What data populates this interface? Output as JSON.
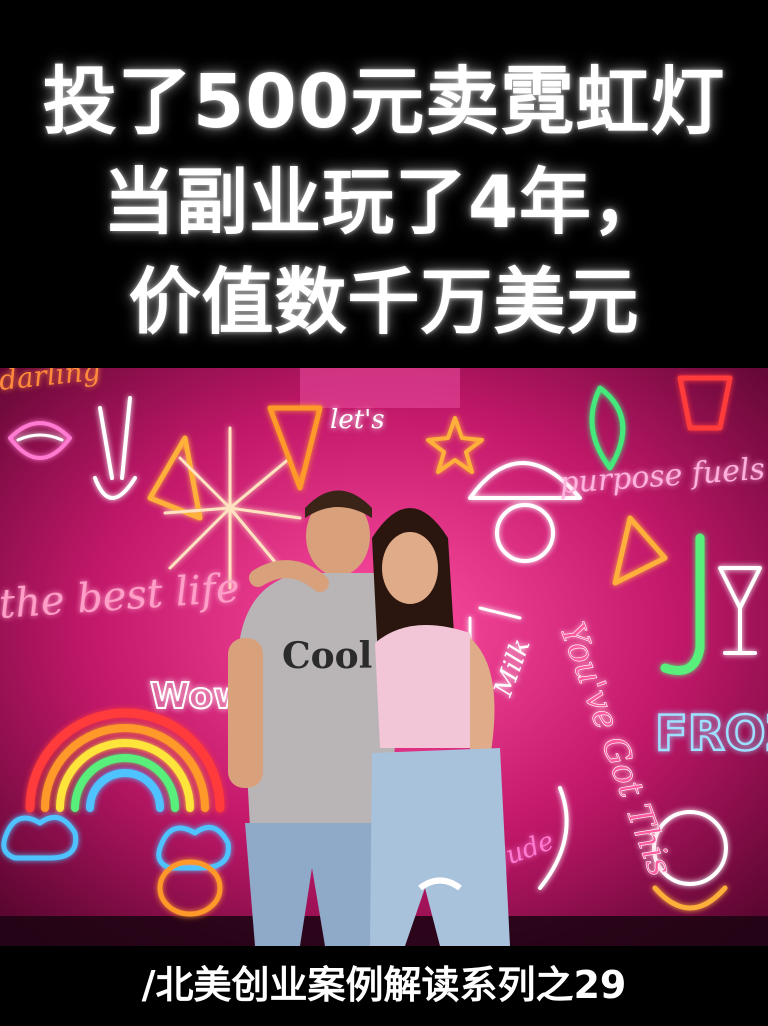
{
  "headline": {
    "line1": "投了500元卖霓虹灯",
    "line2": "当副业玩了4年，",
    "line3": "价值数千万美元"
  },
  "photo": {
    "neon_signs": {
      "wall_left_top": "darling",
      "left_script": "the best life",
      "center_top": "let's",
      "right_script_top": "purpose fuels pa",
      "right_script_mid": "You've Got This",
      "frozen": "FROZEN",
      "rainbow_tag": "Wow",
      "small_sign": "Milk",
      "lower_sign": "Jude"
    },
    "shirt_text": "Cool"
  },
  "footer": {
    "series_caption": "/北美创业案例解读系列之29"
  },
  "colors": {
    "background": "#000000",
    "headline_text": "#ffffff",
    "neon_wall": "#c2186a"
  }
}
